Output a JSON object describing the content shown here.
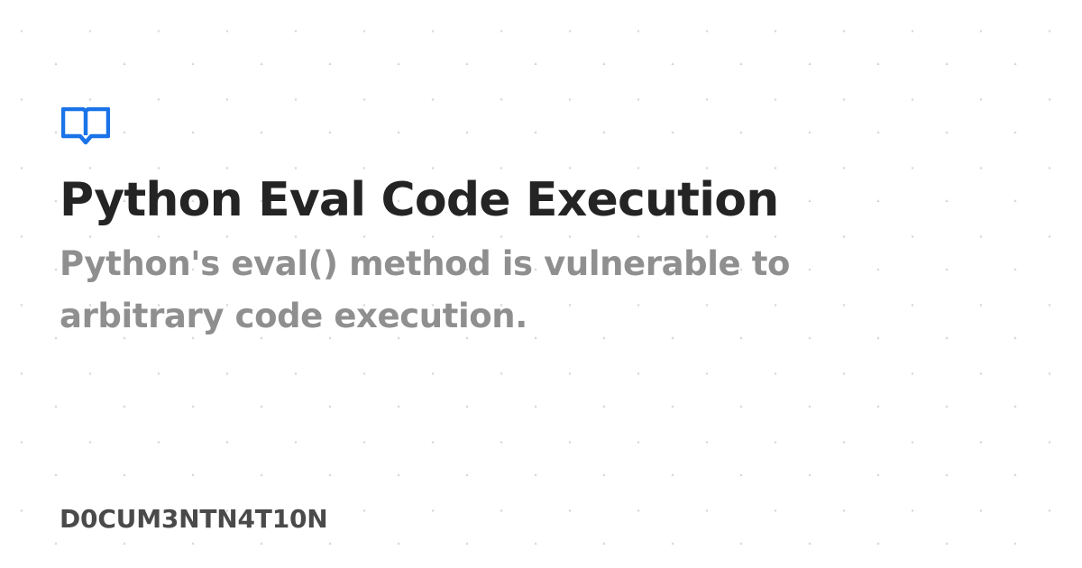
{
  "card": {
    "title": "Python Eval Code Execution",
    "description": "Python's eval() method is vulnerable to arbitrary code execution.",
    "brand": "D0CUM3NTN4T10N",
    "logo_icon": "open-book-icon"
  },
  "colors": {
    "background": "#ffffff",
    "title": "#242424",
    "description": "#8f8f8f",
    "brand": "#4a4a4a",
    "logo": "#1a73e8",
    "dots": "#d3d3d3"
  }
}
